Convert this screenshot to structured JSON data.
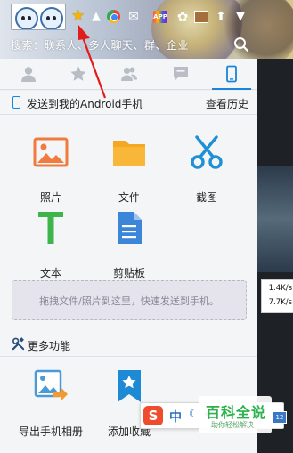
{
  "header": {
    "search_placeholder": "搜索：联系人、多人聊天、群、企业",
    "status_icons": [
      "star-icon",
      "signal-icon",
      "browser-icon",
      "mail-icon",
      "app-icon",
      "gear-icon",
      "upload-icon",
      "shirt-icon"
    ],
    "app_icon_text": "APP"
  },
  "tabs": [
    {
      "name": "contacts",
      "icon": "person-icon",
      "active": false
    },
    {
      "name": "favorites",
      "icon": "star-icon",
      "active": false
    },
    {
      "name": "groups",
      "icon": "group-icon",
      "active": false
    },
    {
      "name": "messages",
      "icon": "chat-icon",
      "active": false
    },
    {
      "name": "phone",
      "icon": "phone-icon",
      "active": true
    }
  ],
  "send_section": {
    "title": "发送到我的Android手机",
    "history_link": "查看历史"
  },
  "tools": [
    {
      "label": "照片",
      "icon": "photo-icon"
    },
    {
      "label": "文件",
      "icon": "folder-icon"
    },
    {
      "label": "截图",
      "icon": "scissors-icon"
    },
    {
      "label": "文本",
      "icon": "text-icon"
    },
    {
      "label": "剪贴板",
      "icon": "clipboard-icon"
    }
  ],
  "dropzone": {
    "text": "拖拽文件/照片到这里，快速发送到手机。"
  },
  "more_section": {
    "title": "更多功能",
    "items": [
      {
        "label": "导出手机相册",
        "icon": "export-album-icon"
      },
      {
        "label": "添加收藏",
        "icon": "bookmark-icon"
      }
    ]
  },
  "network_speed": {
    "up": "1.4K/s",
    "down": "7.7K/s"
  },
  "ime": {
    "logo": "S",
    "lang": "中"
  },
  "watermark": {
    "title": "百科全说",
    "subtitle": "助你轻松解决"
  },
  "colors": {
    "accent": "#1a84d8",
    "photo": "#f07b3f",
    "folder": "#f5a623",
    "scissors": "#1e90d6",
    "text": "#3db54a",
    "clipboard": "#3b86d9",
    "arrow": "#e21b1b"
  }
}
